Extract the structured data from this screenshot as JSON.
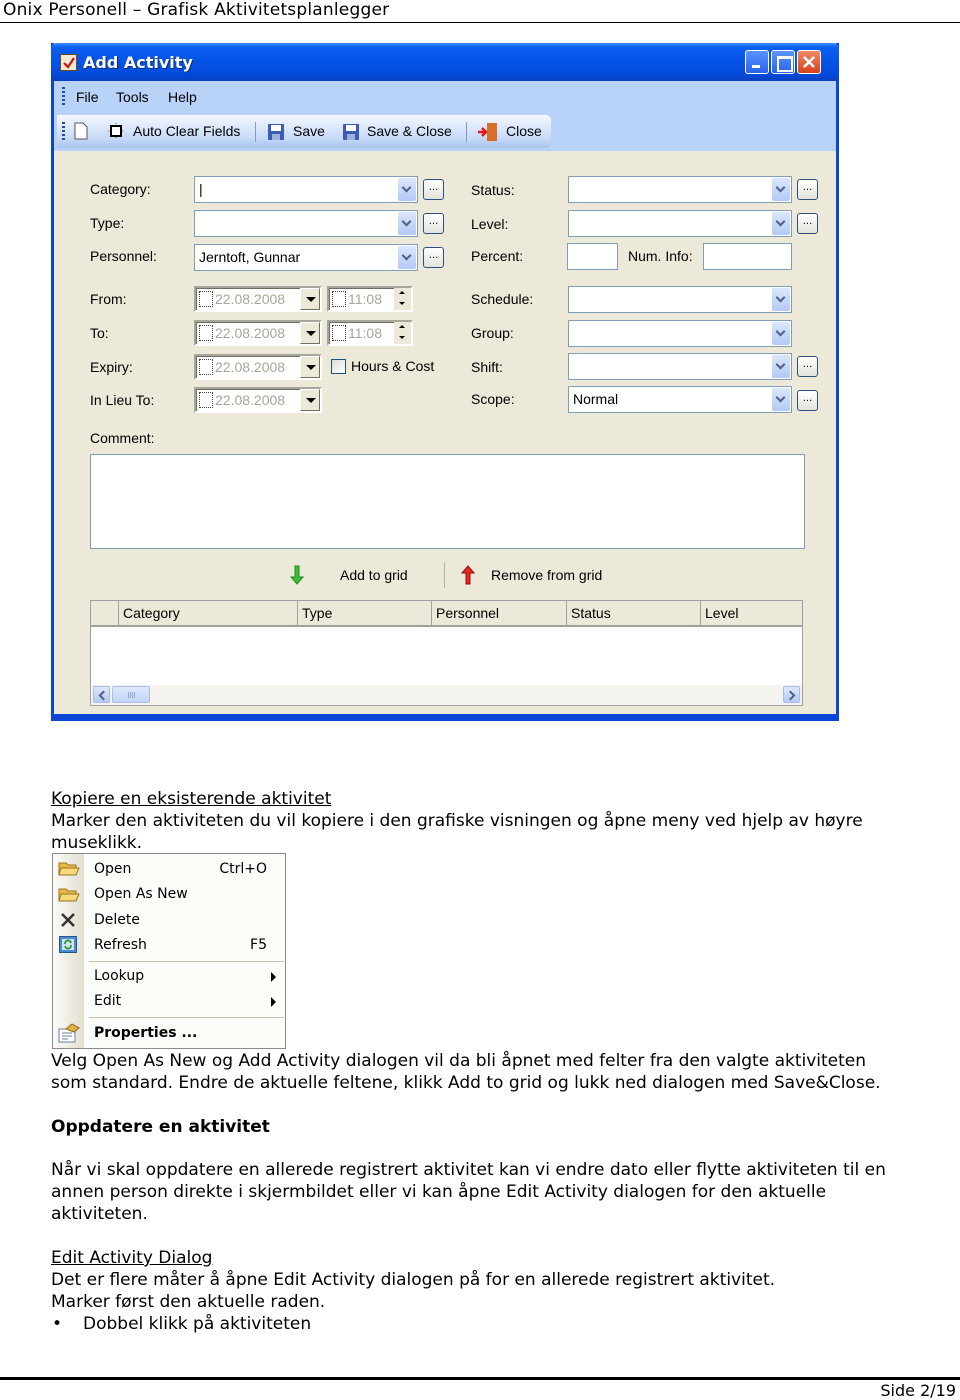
{
  "document": {
    "header_title": "Onix Personell – Grafisk Aktivitetsplanlegger",
    "page_label": "Side 2/19"
  },
  "dialog": {
    "title": "Add Activity",
    "menu": [
      "File",
      "Tools",
      "Help"
    ],
    "toolbar": {
      "auto_clear": "Auto Clear Fields",
      "save": "Save",
      "save_close": "Save & Close",
      "close": "Close"
    },
    "fields": {
      "category": {
        "label": "Category:",
        "value": "|"
      },
      "type": {
        "label": "Type:",
        "value": ""
      },
      "personnel": {
        "label": "Personnel:",
        "value": "Jerntoft, Gunnar"
      },
      "status": {
        "label": "Status:",
        "value": ""
      },
      "level": {
        "label": "Level:",
        "value": ""
      },
      "percent": {
        "label": "Percent:",
        "value": ""
      },
      "num_info": {
        "label": "Num. Info:",
        "value": ""
      },
      "from": {
        "label": "From:",
        "date": "22.08.2008",
        "time": "11:08"
      },
      "to": {
        "label": "To:",
        "date": "22.08.2008",
        "time": "11:08"
      },
      "expiry": {
        "label": "Expiry:",
        "date": "22.08.2008"
      },
      "hours_cost": {
        "label": "Hours & Cost",
        "checked": false
      },
      "in_lieu_to": {
        "label": "In Lieu To:",
        "date": "22.08.2008"
      },
      "schedule": {
        "label": "Schedule:",
        "value": ""
      },
      "group": {
        "label": "Group:",
        "value": ""
      },
      "shift": {
        "label": "Shift:",
        "value": ""
      },
      "scope": {
        "label": "Scope:",
        "value": "Normal"
      },
      "comment": {
        "label": "Comment:",
        "value": ""
      }
    },
    "ellipsis": "...",
    "add_to_grid": "Add to grid",
    "remove_from_grid": "Remove from grid",
    "grid_columns": [
      "Category",
      "Type",
      "Personnel",
      "Status",
      "Level"
    ]
  },
  "section_copy": {
    "heading": "Kopiere en eksisterende aktivitet",
    "line1": "Marker den aktiviteten du vil kopiere i den grafiske visningen og åpne meny ved hjelp av høyre",
    "line2": "museklikk."
  },
  "context_menu": {
    "items": [
      {
        "label": "Open",
        "shortcut": "Ctrl+O"
      },
      {
        "label": "Open As New",
        "shortcut": ""
      },
      {
        "label": "Delete",
        "shortcut": ""
      },
      {
        "label": "Refresh",
        "shortcut": "F5"
      },
      {
        "label": "Lookup",
        "shortcut": ""
      },
      {
        "label": "Edit",
        "shortcut": ""
      },
      {
        "label": "Properties ...",
        "shortcut": ""
      }
    ]
  },
  "after_menu": {
    "line1": "Velg Open As New og Add Activity dialogen vil da bli åpnet med felter fra den valgte aktiviteten",
    "line2": "som standard. Endre de aktuelle feltene, klikk Add to grid og lukk ned dialogen med Save&Close."
  },
  "section_update": {
    "heading": "Oppdatere en aktivitet",
    "line1": "Når vi skal oppdatere en allerede registrert aktivitet kan vi endre dato eller flytte aktiviteten til en",
    "line2": "annen person direkte i skjermbildet eller vi kan åpne Edit Activity dialogen for den aktuelle",
    "line3": "aktiviteten."
  },
  "section_edit": {
    "heading": "Edit Activity Dialog",
    "line1": "Det er flere måter å åpne Edit Activity dialogen på for en allerede registrert aktivitet.",
    "line2": "Marker først den aktuelle raden.",
    "bullet1": "Dobbel klikk på aktiviteten"
  }
}
